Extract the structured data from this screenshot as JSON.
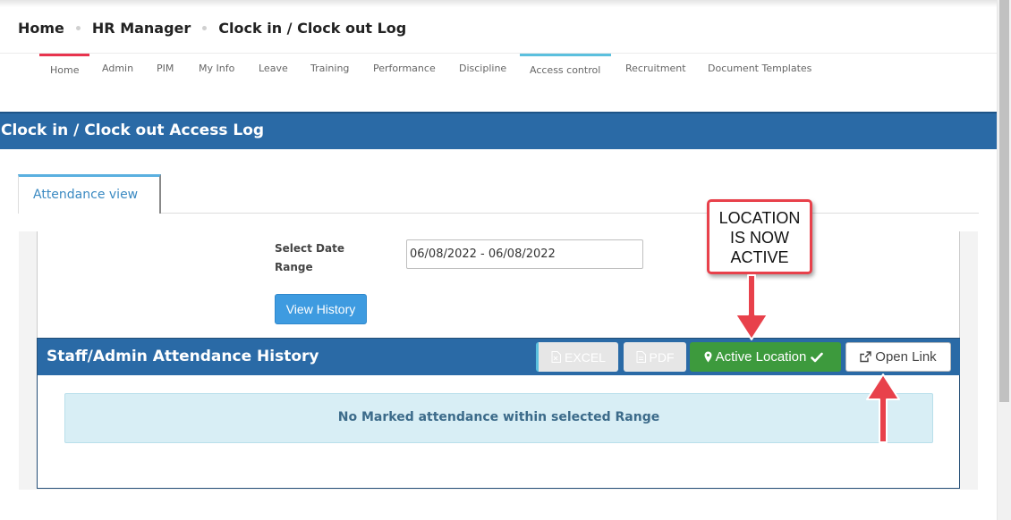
{
  "breadcrumb": [
    "Home",
    "HR Manager",
    "Clock in / Clock out Log"
  ],
  "nav": {
    "items": [
      "Home",
      "Admin",
      "PIM",
      "My Info",
      "Leave",
      "Training",
      "Performance",
      "Discipline",
      "Access control",
      "Recruitment",
      "Document Templates"
    ],
    "active": "Access control"
  },
  "page_title": "Clock in / Clock out Access Log",
  "tabs": [
    {
      "label": "Attendance view",
      "active": true
    }
  ],
  "filter": {
    "label": "Select Date Range",
    "date_range_value": "06/08/2022 - 06/08/2022",
    "view_history_label": "View History"
  },
  "history": {
    "title": "Staff/Admin Attendance History",
    "excel_label": "EXCEL",
    "pdf_label": "PDF",
    "active_location_label": "Active Location",
    "open_link_label": "Open Link",
    "empty_message": "No Marked attendance within selected Range"
  },
  "annotation": {
    "lines": [
      "LOCATION",
      "IS NOW",
      "ACTIVE"
    ]
  },
  "colors": {
    "title_bar": "#2a6aa6",
    "active_green": "#3d9a3d",
    "primary_blue": "#3e9be0",
    "callout_red": "#e8414b",
    "nav_red": "#e8344e",
    "nav_teal": "#5bc0de"
  },
  "icons": {
    "excel": "file-excel-icon",
    "pdf": "file-pdf-icon",
    "location": "map-marker-icon",
    "check": "check-icon",
    "external": "external-link-icon"
  }
}
